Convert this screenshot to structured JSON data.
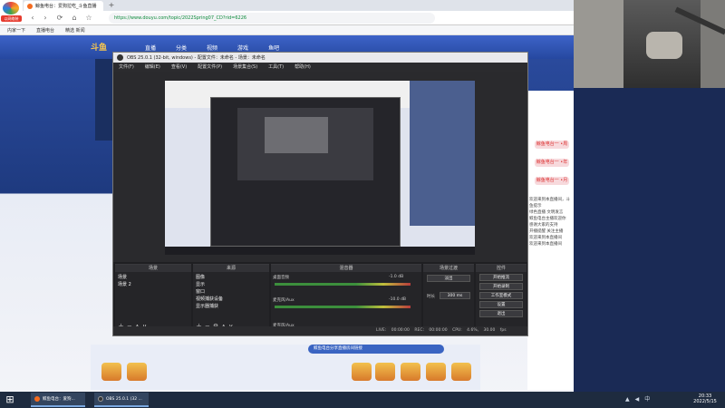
{
  "app": {
    "label": "以网络装"
  },
  "browser": {
    "tab_title": "鲸鱼电台：爱狗拉吃_斗鱼直播",
    "new_tab": "+",
    "url_prefix": "https://",
    "url": "https://www.douyu.com/topic/2022Spring07_CD?rid=6226",
    "nav": {
      "back": "‹",
      "forward": "›",
      "reload": "⟳",
      "home": "⌂",
      "star": "☆"
    },
    "bookmarks": [
      "内家一下",
      "直播电台",
      "精选 新闻"
    ]
  },
  "douyu": {
    "logo": "斗鱼",
    "nav_items": [
      "直播",
      "分类",
      "视频",
      "游戏",
      "鱼吧"
    ],
    "gift_labels": [
      "鲸鱼电台一 •周",
      "鲸鱼电台一 •年",
      "鲸鱼电台一 •月"
    ],
    "chat_lines": [
      "欢迎来到本直播间，斗鱼提示",
      "绿色直播 文明发言",
      "鲸鱼电台主播欢迎你",
      "感谢大家的支持",
      "开播提醒 关注主播",
      "欢迎来到本直播间",
      "欢迎来到本直播间"
    ],
    "banner": "鲸鱼电台分享直播房间链接"
  },
  "obs": {
    "title": "OBS 25.0.1 (32-bit, windows) - 配置文件：未命名 - 场景：未命名",
    "menu": [
      "文件(F)",
      "编辑(E)",
      "查看(V)",
      "配置文件(P)",
      "场景集合(S)",
      "工具(T)",
      "帮助(H)"
    ],
    "docks": {
      "scenes": {
        "title": "场景",
        "items": [
          "场景",
          "场景 2"
        ]
      },
      "sources": {
        "title": "来源",
        "items": [
          "图像",
          "显示",
          "窗口",
          "视频捕获设备",
          "显示器捕获"
        ]
      },
      "mixer": {
        "title": "混音器",
        "tracks": [
          {
            "name": "桌面音频",
            "db": "-1.0 dB"
          },
          {
            "name": "麦克风/Aux",
            "db": "-10.0 dB"
          }
        ],
        "footer": "麦克风/Aux"
      },
      "transitions": {
        "title": "场景过渡",
        "fade": "淡出",
        "duration_label": "时长",
        "duration": "300 ms"
      },
      "controls": {
        "title": "控件",
        "buttons": [
          "开始推流",
          "开始录制",
          "工作室模式",
          "设置",
          "退出"
        ]
      }
    },
    "status": {
      "live": "LIVE: 00:00:00",
      "rec": "REC: 00:00:00",
      "cpu": "CPU: 4.6%, 30.00 fps"
    }
  },
  "taskbar": {
    "start": "⊞",
    "tasks": [
      "鲸鱼电台：爱狗...",
      "OBS 25.0.1 (32 ..."
    ],
    "time": "20:33",
    "date": "2022/5/15"
  }
}
